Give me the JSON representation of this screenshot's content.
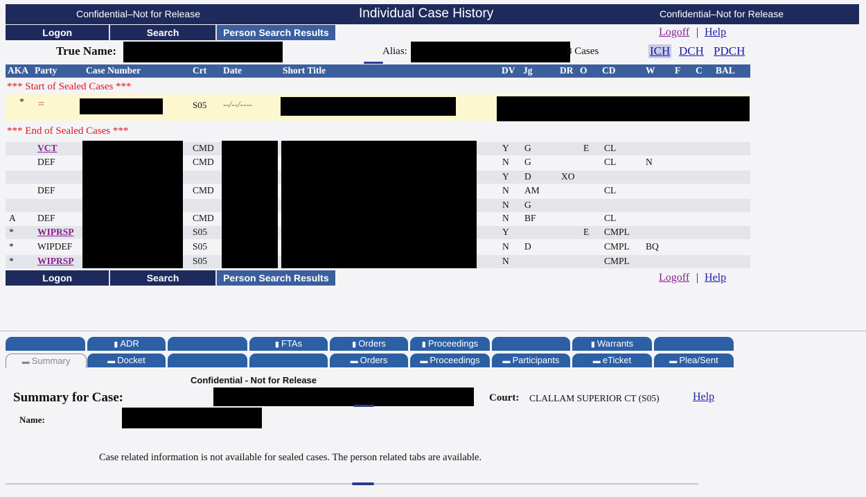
{
  "banner": {
    "left": "Confidential–Not for Release",
    "title": "Individual Case History",
    "right": "Confidential–Not for Release"
  },
  "nav": {
    "logon": "Logon",
    "search": "Search",
    "results": "Person Search Results",
    "logoff": "Logoff",
    "sep": "|",
    "help": "Help"
  },
  "person": {
    "true_name_label": "True Name:",
    "alias_label": "Alias:",
    "cases_count": "8 Cases"
  },
  "history_links": {
    "ich": "ICH",
    "dch": "DCH",
    "pdch": "PDCH"
  },
  "columns": [
    "AKA",
    "Party",
    "Case Number",
    "Crt",
    "Date",
    "Short Title",
    "DV",
    "Jg",
    "DR",
    "O",
    "CD",
    "W",
    "F",
    "C",
    "BAL"
  ],
  "sealed_start": "*** Start of Sealed Cases ***",
  "sealed_end": "*** End of Sealed Cases ***",
  "sealed_row": {
    "aka": "*",
    "party": "=",
    "crt": "S05",
    "date": "--/--/----"
  },
  "cases": [
    {
      "aka": "",
      "party": "VCT",
      "crt": "CMD",
      "dv": "Y",
      "jg": "G",
      "dr": "",
      "o": "E",
      "cd": "CL",
      "w": ""
    },
    {
      "aka": "",
      "party": "DEF",
      "crt": "CMD",
      "dv": "N",
      "jg": "G",
      "dr": "",
      "o": "",
      "cd": "CL",
      "w": "N"
    },
    {
      "aka": "",
      "party": "",
      "crt": "",
      "dv": "Y",
      "jg": "D",
      "dr": "XO",
      "o": "",
      "cd": "",
      "w": ""
    },
    {
      "aka": "",
      "party": "DEF",
      "crt": "CMD",
      "dv": "N",
      "jg": "AM",
      "dr": "",
      "o": "",
      "cd": "CL",
      "w": ""
    },
    {
      "aka": "",
      "party": "",
      "crt": "",
      "dv": "N",
      "jg": "G",
      "dr": "",
      "o": "",
      "cd": "",
      "w": ""
    },
    {
      "aka": "A",
      "party": "DEF",
      "crt": "CMD",
      "dv": "N",
      "jg": "BF",
      "dr": "",
      "o": "",
      "cd": "CL",
      "w": ""
    },
    {
      "aka": "*",
      "party": "WIPRSP",
      "crt": "S05",
      "dv": "Y",
      "jg": "",
      "dr": "",
      "o": "E",
      "cd": "CMPL",
      "w": ""
    },
    {
      "aka": "*",
      "party": "WIPDEF",
      "crt": "S05",
      "dv": "N",
      "jg": "D",
      "dr": "",
      "o": "",
      "cd": "CMPL",
      "w": "BQ"
    },
    {
      "aka": "*",
      "party": "WIPRSP",
      "crt": "S05",
      "dv": "N",
      "jg": "",
      "dr": "",
      "o": "",
      "cd": "CMPL",
      "w": ""
    }
  ],
  "tabs_top": [
    "",
    "ADR",
    "",
    "FTAs",
    "Orders",
    "Proceedings",
    "",
    "Warrants",
    ""
  ],
  "tabs_bottom": [
    "Summary",
    "Docket",
    "",
    "",
    "Orders",
    "Proceedings",
    "Participants",
    "eTicket",
    "Plea/Sent"
  ],
  "summary": {
    "confidential": "Confidential - Not for Release",
    "title": "Summary for Case:",
    "court_label": "Court:",
    "court_value": "CLALLAM SUPERIOR CT (S05)",
    "help": "Help",
    "name_label": "Name:",
    "notice": "Case related information is not available for sealed cases. The person related tabs are available."
  },
  "colors": {
    "navy": "#1f2a5c",
    "header_blue": "#3b5f9c",
    "tab_blue": "#2c5fa4",
    "sealed_red": "#e0151b",
    "link_blue": "#1c1ca8",
    "link_visited": "#8a2090"
  }
}
